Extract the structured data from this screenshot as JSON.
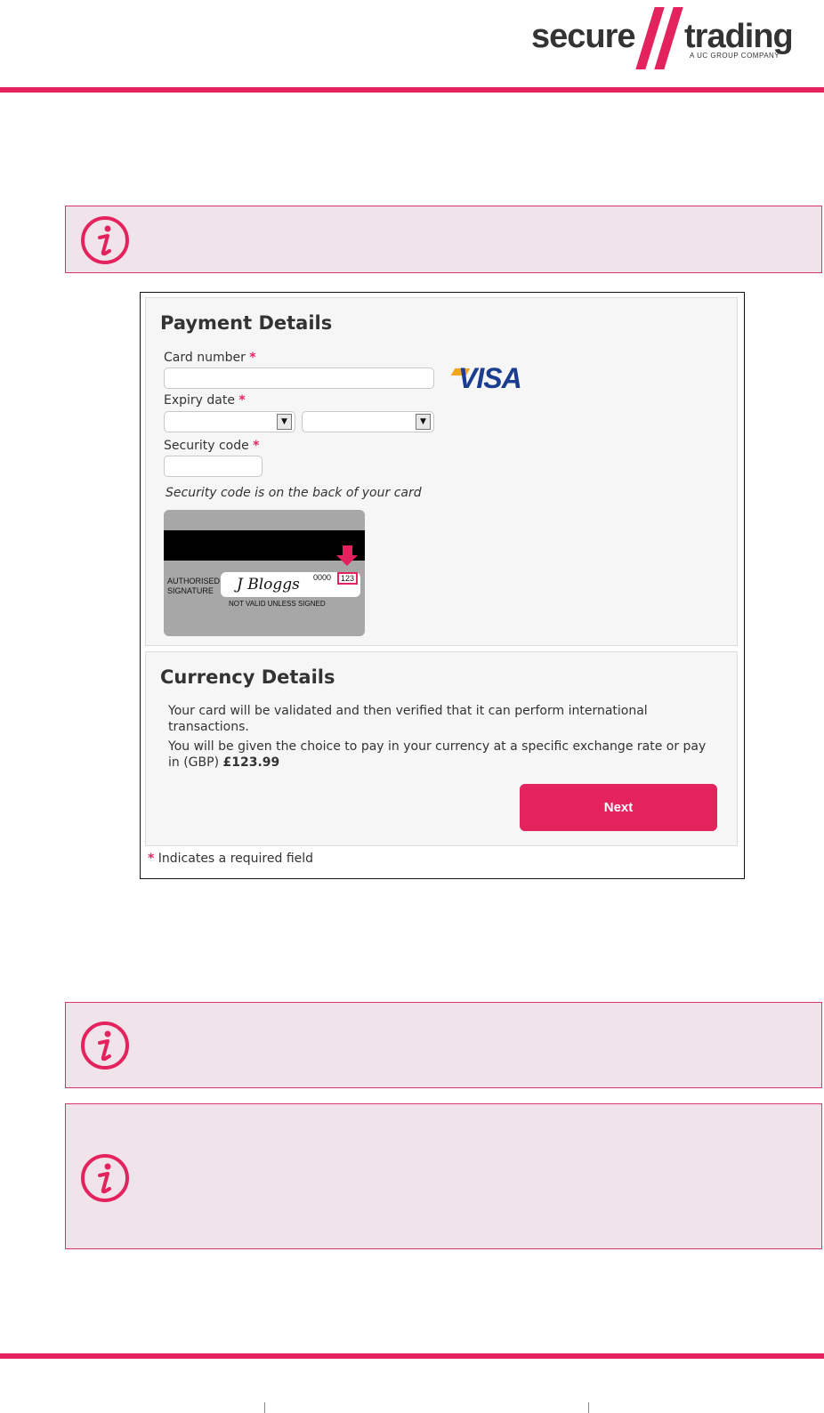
{
  "header": {
    "logo_left": "secure",
    "logo_right": "trading",
    "logo_tagline": "A UC GROUP COMPANY"
  },
  "colors": {
    "brand": "#e4225e",
    "info_bg": "#f0e4ea",
    "visa_blue": "#1a3d8f"
  },
  "icons": {
    "info": "info-icon"
  },
  "payment": {
    "title": "Payment Details",
    "card_number_label": "Card number",
    "expiry_label": "Expiry date",
    "security_label": "Security code",
    "required_mark": "*",
    "security_hint": "Security code is on the back of your card",
    "card_brand": "VISA"
  },
  "card_image": {
    "sig_label_1": "AUTHORISED",
    "sig_label_2": "SIGNATURE",
    "signature": "J Bloggs",
    "digits": "0000",
    "cvv": "123",
    "not_valid": "NOT VALID UNLESS SIGNED"
  },
  "currency": {
    "title": "Currency Details",
    "line1": "Your card will be validated and then verified that it can perform international transactions.",
    "line2_prefix": "You will be given the choice to pay in your currency at a specific exchange rate or pay in (GBP) ",
    "amount": "£123.99",
    "next_label": "Next"
  },
  "footer_note": {
    "mark": "*",
    "text": " Indicates a required field"
  }
}
